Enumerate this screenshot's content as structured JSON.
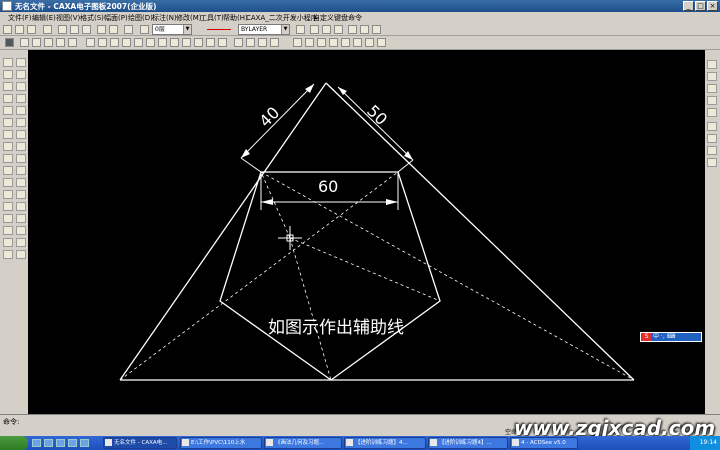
{
  "window": {
    "title": "无名文件 - CAXA电子图板2007(企业版)",
    "controls": [
      "_",
      "□",
      "×"
    ]
  },
  "menu": [
    "文件(F)",
    "编辑(E)",
    "视图(V)",
    "格式(S)",
    "幅面(P)",
    "绘图(D)",
    "标注(N)",
    "修改(M)",
    "工具(T)",
    "帮助(H)",
    "CAXA_二次开发小程序",
    "自定义键盘命令"
  ],
  "toolbar": {
    "layer_value": "0层",
    "linetype_value": "BYLAYER"
  },
  "drawing": {
    "dim_40": "40",
    "dim_50": "50",
    "dim_60": "60",
    "annotation": "如图示作出辅助线"
  },
  "ime": {
    "label": "中 ·, ⌨"
  },
  "command": {
    "prompt": "命令:",
    "status": "空命令"
  },
  "taskbar": {
    "tasks": [
      "无名文件 - CAXA电...",
      "E:\\工作\\PVC\\110上水",
      "《画法几何及习题...",
      "【进阶训练习题】4...",
      "【进阶训练习题4】...",
      "4 - ACDSee v5.0"
    ],
    "clock": "19:14"
  },
  "watermark": "www.zgjxcad.com",
  "colors": {
    "canvas": "#000000",
    "lines": "#ffffff"
  }
}
